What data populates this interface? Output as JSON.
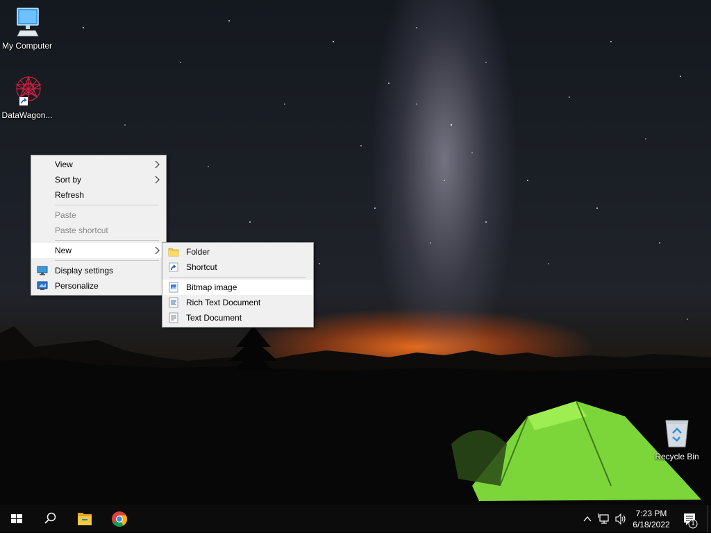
{
  "desktop": {
    "icons": [
      {
        "label": "My Computer",
        "icon": "computer-icon"
      },
      {
        "label": "DataWagon...",
        "icon": "datawagon-shortcut-icon"
      },
      {
        "label": "Recycle Bin",
        "icon": "recycle-bin-icon"
      }
    ]
  },
  "context_menu": {
    "items": [
      {
        "label": "View",
        "has_submenu": true
      },
      {
        "label": "Sort by",
        "has_submenu": true
      },
      {
        "label": "Refresh"
      },
      {
        "label": "Paste",
        "disabled": true
      },
      {
        "label": "Paste shortcut",
        "disabled": true
      },
      {
        "label": "New",
        "has_submenu": true,
        "highlighted": true
      },
      {
        "label": "Display settings",
        "icon": "display-settings-icon"
      },
      {
        "label": "Personalize",
        "icon": "personalize-icon"
      }
    ]
  },
  "new_submenu": {
    "items": [
      {
        "label": "Folder",
        "icon": "folder-icon"
      },
      {
        "label": "Shortcut",
        "icon": "shortcut-icon"
      },
      {
        "label": "Bitmap image",
        "icon": "bitmap-image-icon",
        "highlighted": true
      },
      {
        "label": "Rich Text Document",
        "icon": "rich-text-document-icon"
      },
      {
        "label": "Text Document",
        "icon": "text-document-icon"
      }
    ]
  },
  "taskbar": {
    "buttons": [
      "start-button",
      "search-button",
      "file-explorer-button",
      "chrome-button"
    ],
    "tray_icons": [
      "show-hidden-icons",
      "network-icon",
      "volume-icon"
    ],
    "clock": {
      "time": "7:23 PM",
      "date": "6/18/2022"
    },
    "notification_count": "1"
  },
  "colors": {
    "menu_background": "#f0f0f0",
    "menu_highlight": "#ffffff",
    "disabled_text": "#8a8a8a",
    "taskbar": "#0c0c0c",
    "tent_green": "#7cd63a"
  }
}
